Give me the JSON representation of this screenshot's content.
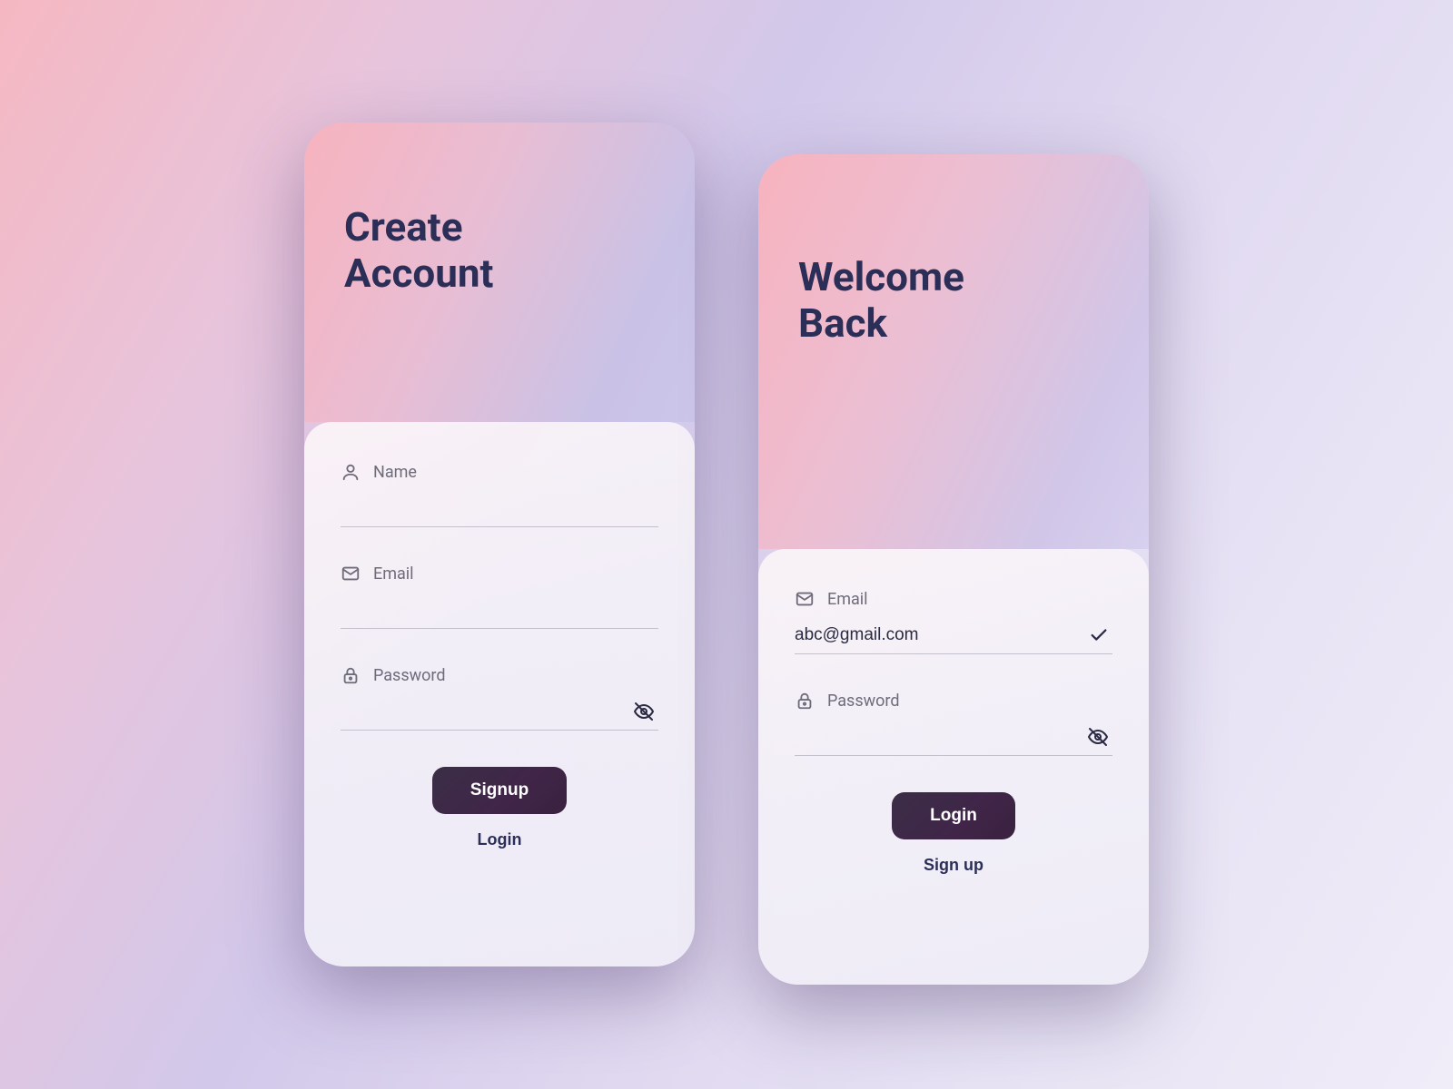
{
  "signup_card": {
    "title": "Create\nAccount",
    "fields": {
      "name": {
        "label": "Name",
        "value": ""
      },
      "email": {
        "label": "Email",
        "value": ""
      },
      "password": {
        "label": "Password",
        "value": ""
      }
    },
    "primary_btn": "Signup",
    "secondary_btn": "Login"
  },
  "login_card": {
    "title": "Welcome\nBack",
    "fields": {
      "email": {
        "label": "Email",
        "value": "abc@gmail.com"
      },
      "password": {
        "label": "Password",
        "value": ""
      }
    },
    "primary_btn": "Login",
    "secondary_btn": "Sign up"
  }
}
